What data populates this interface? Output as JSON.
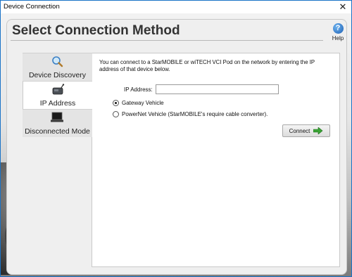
{
  "window": {
    "title": "Device Connection",
    "close_glyph": "✕"
  },
  "header": {
    "title": "Select Connection Method",
    "help_glyph": "?",
    "help_label": "Help"
  },
  "tabs": [
    {
      "label": "Device Discovery",
      "icon": "magnifier-icon"
    },
    {
      "label": "IP Address",
      "icon": "wireless-device-icon"
    },
    {
      "label": "Disconnected Mode",
      "icon": "laptop-icon"
    }
  ],
  "ip_panel": {
    "description": "You can connect to a StarMOBILE or wiTECH VCI Pod on the network by entering the IP address of that device below.",
    "ip_label": "IP Address:",
    "ip_value": "",
    "options": [
      {
        "label": "Gateway Vehicle",
        "selected": true
      },
      {
        "label": "PowerNet Vehicle (StarMOBILE's require cable converter).",
        "selected": false
      }
    ],
    "connect_label": "Connect"
  }
}
